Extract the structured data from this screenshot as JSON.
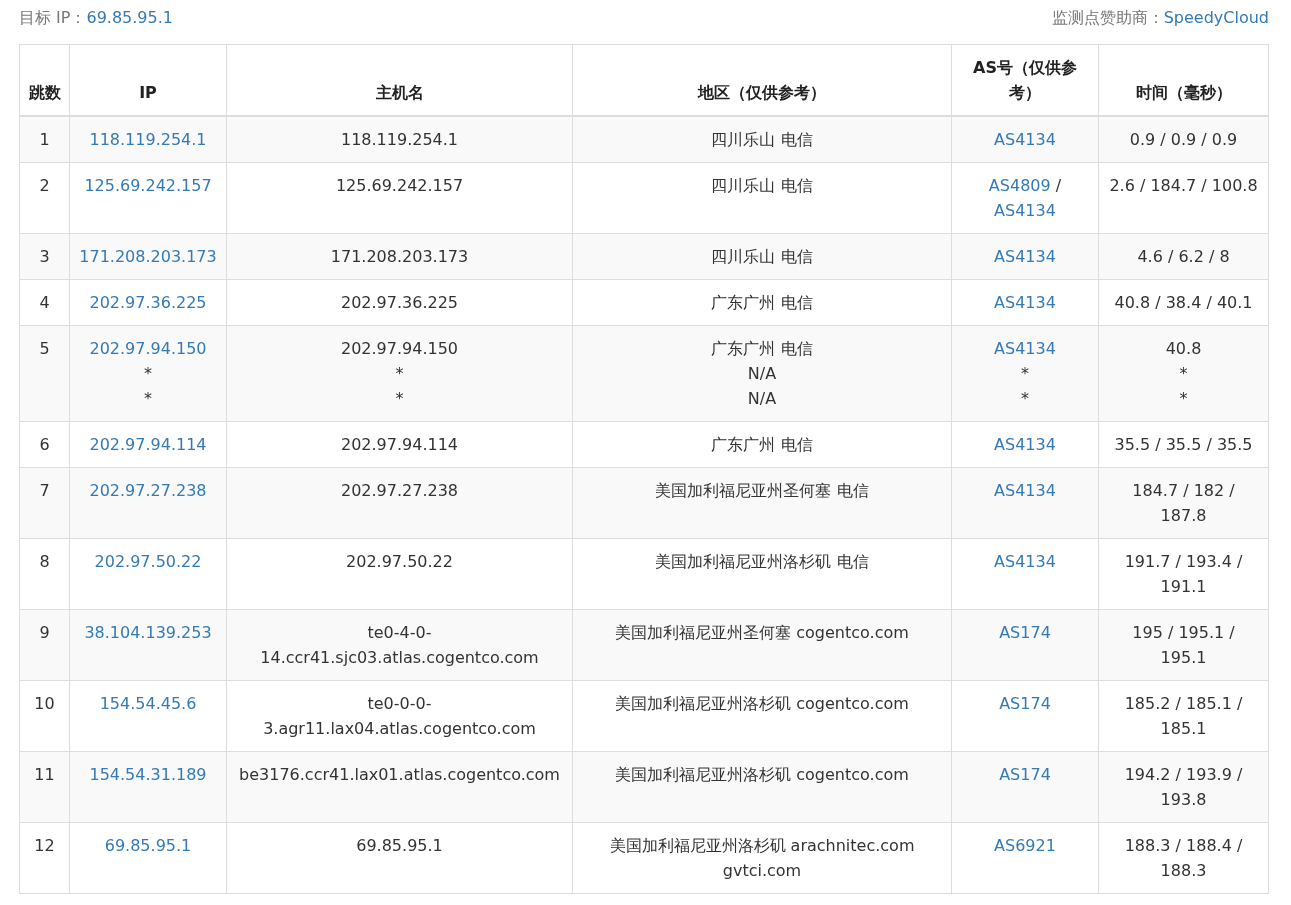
{
  "target": {
    "label": "目标 IP：",
    "value": "69.85.95.1"
  },
  "sponsor": {
    "label": "监测点赞助商：",
    "value": "SpeedyCloud"
  },
  "table": {
    "columns": [
      "跳数",
      "IP",
      "主机名",
      "地区（仅供参考）",
      "AS号（仅供参考）",
      "时间（毫秒）"
    ],
    "rows": [
      [
        [
          {
            "text": "1",
            "kind": "text"
          }
        ],
        [
          {
            "text": "118.119.254.1",
            "kind": "link"
          }
        ],
        [
          {
            "text": "118.119.254.1",
            "kind": "text"
          }
        ],
        [
          {
            "text": "四川乐山 电信",
            "kind": "text"
          }
        ],
        [
          {
            "text": "AS4134",
            "kind": "link"
          }
        ],
        [
          {
            "text": "0.9 / 0.9 / 0.9",
            "kind": "text"
          }
        ]
      ],
      [
        [
          {
            "text": "2",
            "kind": "text"
          }
        ],
        [
          {
            "text": "125.69.242.157",
            "kind": "link"
          }
        ],
        [
          {
            "text": "125.69.242.157",
            "kind": "text"
          }
        ],
        [
          {
            "text": "四川乐山 电信",
            "kind": "text"
          }
        ],
        [
          {
            "text": "AS4809",
            "kind": "link"
          },
          {
            "text": "/",
            "kind": "text"
          },
          {
            "text": "AS4134",
            "kind": "link"
          }
        ],
        [
          {
            "text": "2.6 / 184.7 / 100.8",
            "kind": "text"
          }
        ]
      ],
      [
        [
          {
            "text": "3",
            "kind": "text"
          }
        ],
        [
          {
            "text": "171.208.203.173",
            "kind": "link"
          }
        ],
        [
          {
            "text": "171.208.203.173",
            "kind": "text"
          }
        ],
        [
          {
            "text": "四川乐山 电信",
            "kind": "text"
          }
        ],
        [
          {
            "text": "AS4134",
            "kind": "link"
          }
        ],
        [
          {
            "text": "4.6 / 6.2 / 8",
            "kind": "text"
          }
        ]
      ],
      [
        [
          {
            "text": "4",
            "kind": "text"
          }
        ],
        [
          {
            "text": "202.97.36.225",
            "kind": "link"
          }
        ],
        [
          {
            "text": "202.97.36.225",
            "kind": "text"
          }
        ],
        [
          {
            "text": "广东广州 电信",
            "kind": "text"
          }
        ],
        [
          {
            "text": "AS4134",
            "kind": "link"
          }
        ],
        [
          {
            "text": "40.8 / 38.4 / 40.1",
            "kind": "text"
          }
        ]
      ],
      [
        [
          {
            "text": "5",
            "kind": "text"
          }
        ],
        [
          {
            "text": "202.97.94.150",
            "kind": "link"
          },
          {
            "text": "*",
            "kind": "line"
          },
          {
            "text": "*",
            "kind": "line"
          }
        ],
        [
          {
            "text": "202.97.94.150",
            "kind": "line"
          },
          {
            "text": "*",
            "kind": "line"
          },
          {
            "text": "*",
            "kind": "line"
          }
        ],
        [
          {
            "text": "广东广州 电信",
            "kind": "line"
          },
          {
            "text": "N/A",
            "kind": "line"
          },
          {
            "text": "N/A",
            "kind": "line"
          }
        ],
        [
          {
            "text": "AS4134",
            "kind": "link"
          },
          {
            "text": "*",
            "kind": "line"
          },
          {
            "text": "*",
            "kind": "line"
          }
        ],
        [
          {
            "text": "40.8",
            "kind": "line"
          },
          {
            "text": "*",
            "kind": "line"
          },
          {
            "text": "*",
            "kind": "line"
          }
        ]
      ],
      [
        [
          {
            "text": "6",
            "kind": "text"
          }
        ],
        [
          {
            "text": "202.97.94.114",
            "kind": "link"
          }
        ],
        [
          {
            "text": "202.97.94.114",
            "kind": "text"
          }
        ],
        [
          {
            "text": "广东广州 电信",
            "kind": "text"
          }
        ],
        [
          {
            "text": "AS4134",
            "kind": "link"
          }
        ],
        [
          {
            "text": "35.5 / 35.5 / 35.5",
            "kind": "text"
          }
        ]
      ],
      [
        [
          {
            "text": "7",
            "kind": "text"
          }
        ],
        [
          {
            "text": "202.97.27.238",
            "kind": "link"
          }
        ],
        [
          {
            "text": "202.97.27.238",
            "kind": "text"
          }
        ],
        [
          {
            "text": "美国加利福尼亚州圣何塞 电信",
            "kind": "text"
          }
        ],
        [
          {
            "text": "AS4134",
            "kind": "link"
          }
        ],
        [
          {
            "text": "184.7 / 182 / 187.8",
            "kind": "text"
          }
        ]
      ],
      [
        [
          {
            "text": "8",
            "kind": "text"
          }
        ],
        [
          {
            "text": "202.97.50.22",
            "kind": "link"
          }
        ],
        [
          {
            "text": "202.97.50.22",
            "kind": "text"
          }
        ],
        [
          {
            "text": "美国加利福尼亚州洛杉矶 电信",
            "kind": "text"
          }
        ],
        [
          {
            "text": "AS4134",
            "kind": "link"
          }
        ],
        [
          {
            "text": "191.7 / 193.4 / 191.1",
            "kind": "text"
          }
        ]
      ],
      [
        [
          {
            "text": "9",
            "kind": "text"
          }
        ],
        [
          {
            "text": "38.104.139.253",
            "kind": "link"
          }
        ],
        [
          {
            "text": "te0-4-0-14.ccr41.sjc03.atlas.cogentco.com",
            "kind": "text"
          }
        ],
        [
          {
            "text": "美国加利福尼亚州圣何塞 cogentco.com",
            "kind": "text"
          }
        ],
        [
          {
            "text": "AS174",
            "kind": "link"
          }
        ],
        [
          {
            "text": "195 / 195.1 / 195.1",
            "kind": "text"
          }
        ]
      ],
      [
        [
          {
            "text": "10",
            "kind": "text"
          }
        ],
        [
          {
            "text": "154.54.45.6",
            "kind": "link"
          }
        ],
        [
          {
            "text": "te0-0-0-3.agr11.lax04.atlas.cogentco.com",
            "kind": "text"
          }
        ],
        [
          {
            "text": "美国加利福尼亚州洛杉矶 cogentco.com",
            "kind": "text"
          }
        ],
        [
          {
            "text": "AS174",
            "kind": "link"
          }
        ],
        [
          {
            "text": "185.2 / 185.1 / 185.1",
            "kind": "text"
          }
        ]
      ],
      [
        [
          {
            "text": "11",
            "kind": "text"
          }
        ],
        [
          {
            "text": "154.54.31.189",
            "kind": "link"
          }
        ],
        [
          {
            "text": "be3176.ccr41.lax01.atlas.cogentco.com",
            "kind": "text"
          }
        ],
        [
          {
            "text": "美国加利福尼亚州洛杉矶 cogentco.com",
            "kind": "text"
          }
        ],
        [
          {
            "text": "AS174",
            "kind": "link"
          }
        ],
        [
          {
            "text": "194.2 / 193.9 / 193.8",
            "kind": "text"
          }
        ]
      ],
      [
        [
          {
            "text": "12",
            "kind": "text"
          }
        ],
        [
          {
            "text": "69.85.95.1",
            "kind": "link"
          }
        ],
        [
          {
            "text": "69.85.95.1",
            "kind": "text"
          }
        ],
        [
          {
            "text": "美国加利福尼亚州洛杉矶 arachnitec.com gvtci.com",
            "kind": "text"
          }
        ],
        [
          {
            "text": "AS6921",
            "kind": "link"
          }
        ],
        [
          {
            "text": "188.3 / 188.4 / 188.3",
            "kind": "text"
          }
        ]
      ]
    ]
  }
}
